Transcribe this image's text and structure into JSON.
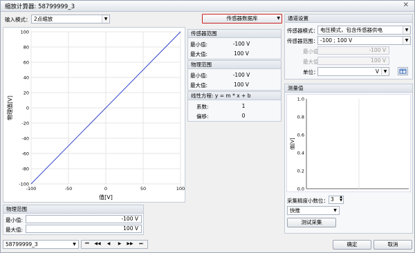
{
  "window": {
    "title": "缩放计算器: 58799999_3",
    "close_glyph": "✕"
  },
  "input_mode": {
    "label": "输入模式：",
    "value": "2点缩放"
  },
  "sensor_db_button": "传感器数据库",
  "chart": {
    "xlabel": "值[V]",
    "ylabel": "物理值[V]",
    "x_ticks": [
      "-100",
      "-50",
      "0",
      "50",
      "100"
    ],
    "y_ticks": [
      "100",
      "80",
      "60",
      "40",
      "20",
      "0",
      "-20",
      "-40",
      "-60",
      "-80",
      "-100"
    ]
  },
  "chart_data": {
    "type": "line",
    "x": [
      -100,
      100
    ],
    "series": [
      {
        "values": [
          -100,
          100
        ]
      }
    ],
    "xlabel": "值[V]",
    "ylabel": "物理值[V]",
    "xlim": [
      -100,
      100
    ],
    "ylim": [
      -100,
      100
    ],
    "grid": true
  },
  "sensor_range": {
    "title": "传感器范围",
    "min_label": "最小值:",
    "min_value": "-100 V",
    "max_label": "最大值:",
    "max_value": "100 V"
  },
  "physical_range": {
    "title": "物理范围",
    "min_label": "最小值:",
    "min_value": "-100 V",
    "max_label": "最大值:",
    "max_value": "100 V"
  },
  "linear_eq": {
    "title": "线性方程: y = m * x + b",
    "coef_label": "系数:",
    "coef_value": "1",
    "offset_label": "偏移:",
    "offset_value": "0"
  },
  "channel_settings": {
    "title": "通道设置",
    "sensor_mode_label": "传感器模式：",
    "sensor_mode_value": "电压模式，包含传感器供电",
    "sensor_range_label": "传感器范围：",
    "sensor_range_value": "-100 ; 100 V",
    "min_label": "最小值:",
    "min_value": "-100 V",
    "max_label": "最大值:",
    "max_value": "100 V",
    "unit_label": "单位：",
    "unit_value": "V"
  },
  "measurement": {
    "title": "测量值",
    "ylabel": "值[V]",
    "y_ticks": [
      "1.0",
      "0.8",
      "0.6",
      "0.4",
      "0.2",
      "0.0"
    ],
    "precision_label": "采集精度小数位：",
    "precision_value": "3",
    "speed_value": "快推",
    "test_button": "测试采集"
  },
  "bottom_physical": {
    "title": "物理范围",
    "min_label": "最小值:",
    "min_value": "-100 V",
    "max_label": "最大值:",
    "max_value": "100 V"
  },
  "channel_select": "58799999_3",
  "nav": {
    "first": "⏮",
    "prev2": "◀◀",
    "prev": "◀",
    "next": "▶",
    "next2": "▶▶",
    "last": "⏭"
  },
  "footer": {
    "ok": "确定",
    "cancel": "取消"
  },
  "colors": {
    "line": "#3344cc",
    "highlight_border": "#cc2222"
  }
}
